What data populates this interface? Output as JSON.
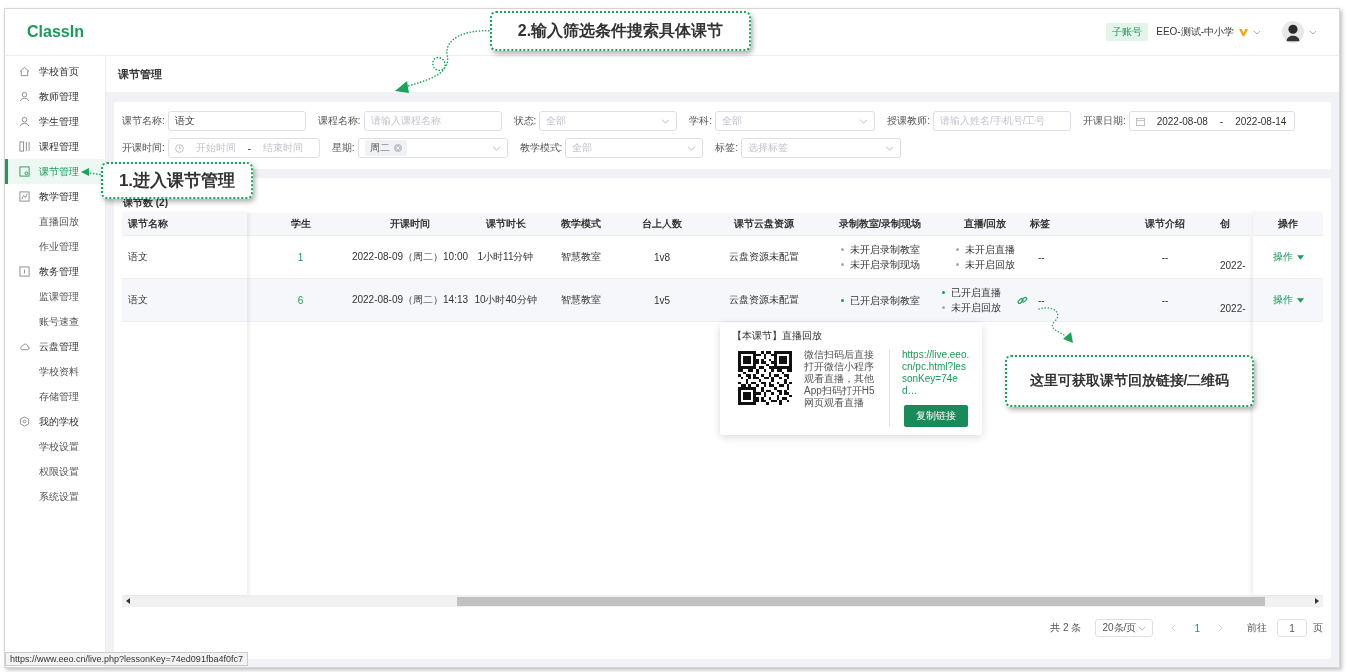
{
  "header": {
    "logo": "ClassIn",
    "account_badge": "子账号",
    "org_name": "EEO-测试-中小学"
  },
  "sidebar": {
    "items": [
      {
        "label": "学校首页",
        "selected": false
      },
      {
        "label": "教师管理",
        "selected": false
      },
      {
        "label": "学生管理",
        "selected": false
      },
      {
        "label": "课程管理",
        "selected": false
      },
      {
        "label": "课节管理",
        "selected": true
      },
      {
        "label": "教学管理",
        "selected": false,
        "children": [
          {
            "label": "直播回放",
            "selected": false
          },
          {
            "label": "作业管理",
            "selected": false
          }
        ]
      },
      {
        "label": "教务管理",
        "selected": false,
        "children": [
          {
            "label": "监课管理",
            "selected": false
          },
          {
            "label": "账号速查",
            "selected": false
          }
        ]
      },
      {
        "label": "云盘管理",
        "selected": false,
        "children": [
          {
            "label": "学校资料",
            "selected": false
          },
          {
            "label": "存储管理",
            "selected": false
          }
        ]
      },
      {
        "label": "我的学校",
        "selected": false,
        "children": [
          {
            "label": "学校设置",
            "selected": false
          },
          {
            "label": "权限设置",
            "selected": false
          },
          {
            "label": "系统设置",
            "selected": false
          }
        ]
      }
    ]
  },
  "page_title": "课节管理",
  "filter_rows": [
    {
      "fields": [
        {
          "kind": "input",
          "label": "课节名称:",
          "value": "语文"
        },
        {
          "kind": "input",
          "label": "课程名称:",
          "placeholder": "请输入课程名称"
        },
        {
          "kind": "select",
          "label": "状态:",
          "placeholder": "全部"
        },
        {
          "kind": "select",
          "label": "学科:",
          "placeholder": "全部"
        },
        {
          "kind": "input",
          "label": "授课教师:",
          "placeholder": "请输入姓名/手机号/工号"
        },
        {
          "kind": "daterange",
          "label": "开课日期:",
          "start": "2022-08-08",
          "separator": "-",
          "end": "2022-08-14"
        }
      ]
    },
    {
      "fields": [
        {
          "kind": "timerange",
          "label": "开课时间:",
          "start_placeholder": "开始时间",
          "separator": "-",
          "end_placeholder": "结束时间"
        },
        {
          "kind": "tagselect",
          "label": "星期:",
          "tags": [
            "周二"
          ]
        },
        {
          "kind": "select",
          "label": "教学模式:",
          "placeholder": "全部"
        },
        {
          "kind": "select",
          "label": "标签:",
          "placeholder": "选择标签"
        }
      ]
    }
  ],
  "table": {
    "title": "课节数 (2)",
    "columns": [
      "课节名称",
      "学生",
      "开课时间",
      "课节时长",
      "教学模式",
      "台上人数",
      "课节云盘资源",
      "录制教室/录制现场",
      "直播/回放",
      "标签",
      "课节介绍",
      "创",
      "操作"
    ],
    "rows": [
      {
        "cells": [
          {
            "kind": "text",
            "text": "语文"
          },
          {
            "kind": "link",
            "text": "1"
          },
          {
            "kind": "text",
            "text": "2022-08-09（周二）10:00"
          },
          {
            "kind": "text",
            "text": "1小时11分钟"
          },
          {
            "kind": "text",
            "text": "智慧教室"
          },
          {
            "kind": "text",
            "text": "1v8"
          },
          {
            "kind": "text",
            "text": "云盘资源未配置"
          },
          {
            "kind": "status_list",
            "items": [
              {
                "text": "未开启录制教室",
                "on": false
              },
              {
                "text": "未开启录制现场",
                "on": false
              }
            ]
          },
          {
            "kind": "status_list",
            "share_link": false,
            "items": [
              {
                "text": "未开启直播",
                "on": false
              },
              {
                "text": "未开启回放",
                "on": false
              }
            ]
          },
          {
            "kind": "text",
            "text": "--"
          },
          {
            "kind": "text",
            "text": "--"
          },
          {
            "kind": "text",
            "text": "2022-"
          },
          {
            "kind": "dropdown",
            "text": "操作"
          }
        ]
      },
      {
        "cells": [
          {
            "kind": "text",
            "text": "语文"
          },
          {
            "kind": "link",
            "text": "6"
          },
          {
            "kind": "text",
            "text": "2022-08-09（周二）14:13"
          },
          {
            "kind": "text",
            "text": "10小时40分钟"
          },
          {
            "kind": "text",
            "text": "智慧教室"
          },
          {
            "kind": "text",
            "text": "1v5"
          },
          {
            "kind": "text",
            "text": "云盘资源未配置"
          },
          {
            "kind": "status_list",
            "items": [
              {
                "text": "已开启录制教室",
                "on": true
              }
            ]
          },
          {
            "kind": "status_list",
            "share_link": true,
            "items": [
              {
                "text": "已开启直播",
                "on": true
              },
              {
                "text": "未开启回放",
                "on": false
              }
            ]
          },
          {
            "kind": "text",
            "text": "--"
          },
          {
            "kind": "text",
            "text": "--"
          },
          {
            "kind": "text",
            "text": "2022-"
          },
          {
            "kind": "dropdown",
            "text": "操作"
          }
        ]
      }
    ]
  },
  "popover": {
    "title": "【本课节】直播回放",
    "description": "微信扫码后直接打开微信小程序观看直播，其他App扫码打开H5网页观看直播",
    "url": "https://live.eeo.cn/pc.html?lessonKey=74ed…",
    "button": "复制链接"
  },
  "pagination": {
    "total": "共 2 条",
    "page_size": "20条/页",
    "pages": [
      {
        "label": "1",
        "selected": true
      }
    ],
    "goto_label": "前往",
    "goto_value": "1",
    "goto_suffix": "页"
  },
  "annotations": [
    {
      "text": "1.进入课节管理"
    },
    {
      "text": "2.输入筛选条件搜索具体课节"
    },
    {
      "text": "这里可获取课节回放链接/二维码"
    }
  ],
  "status_bar": {
    "url": "https://www.eeo.cn/live.php?lessonKey=74ed091fba4f0fc7"
  }
}
